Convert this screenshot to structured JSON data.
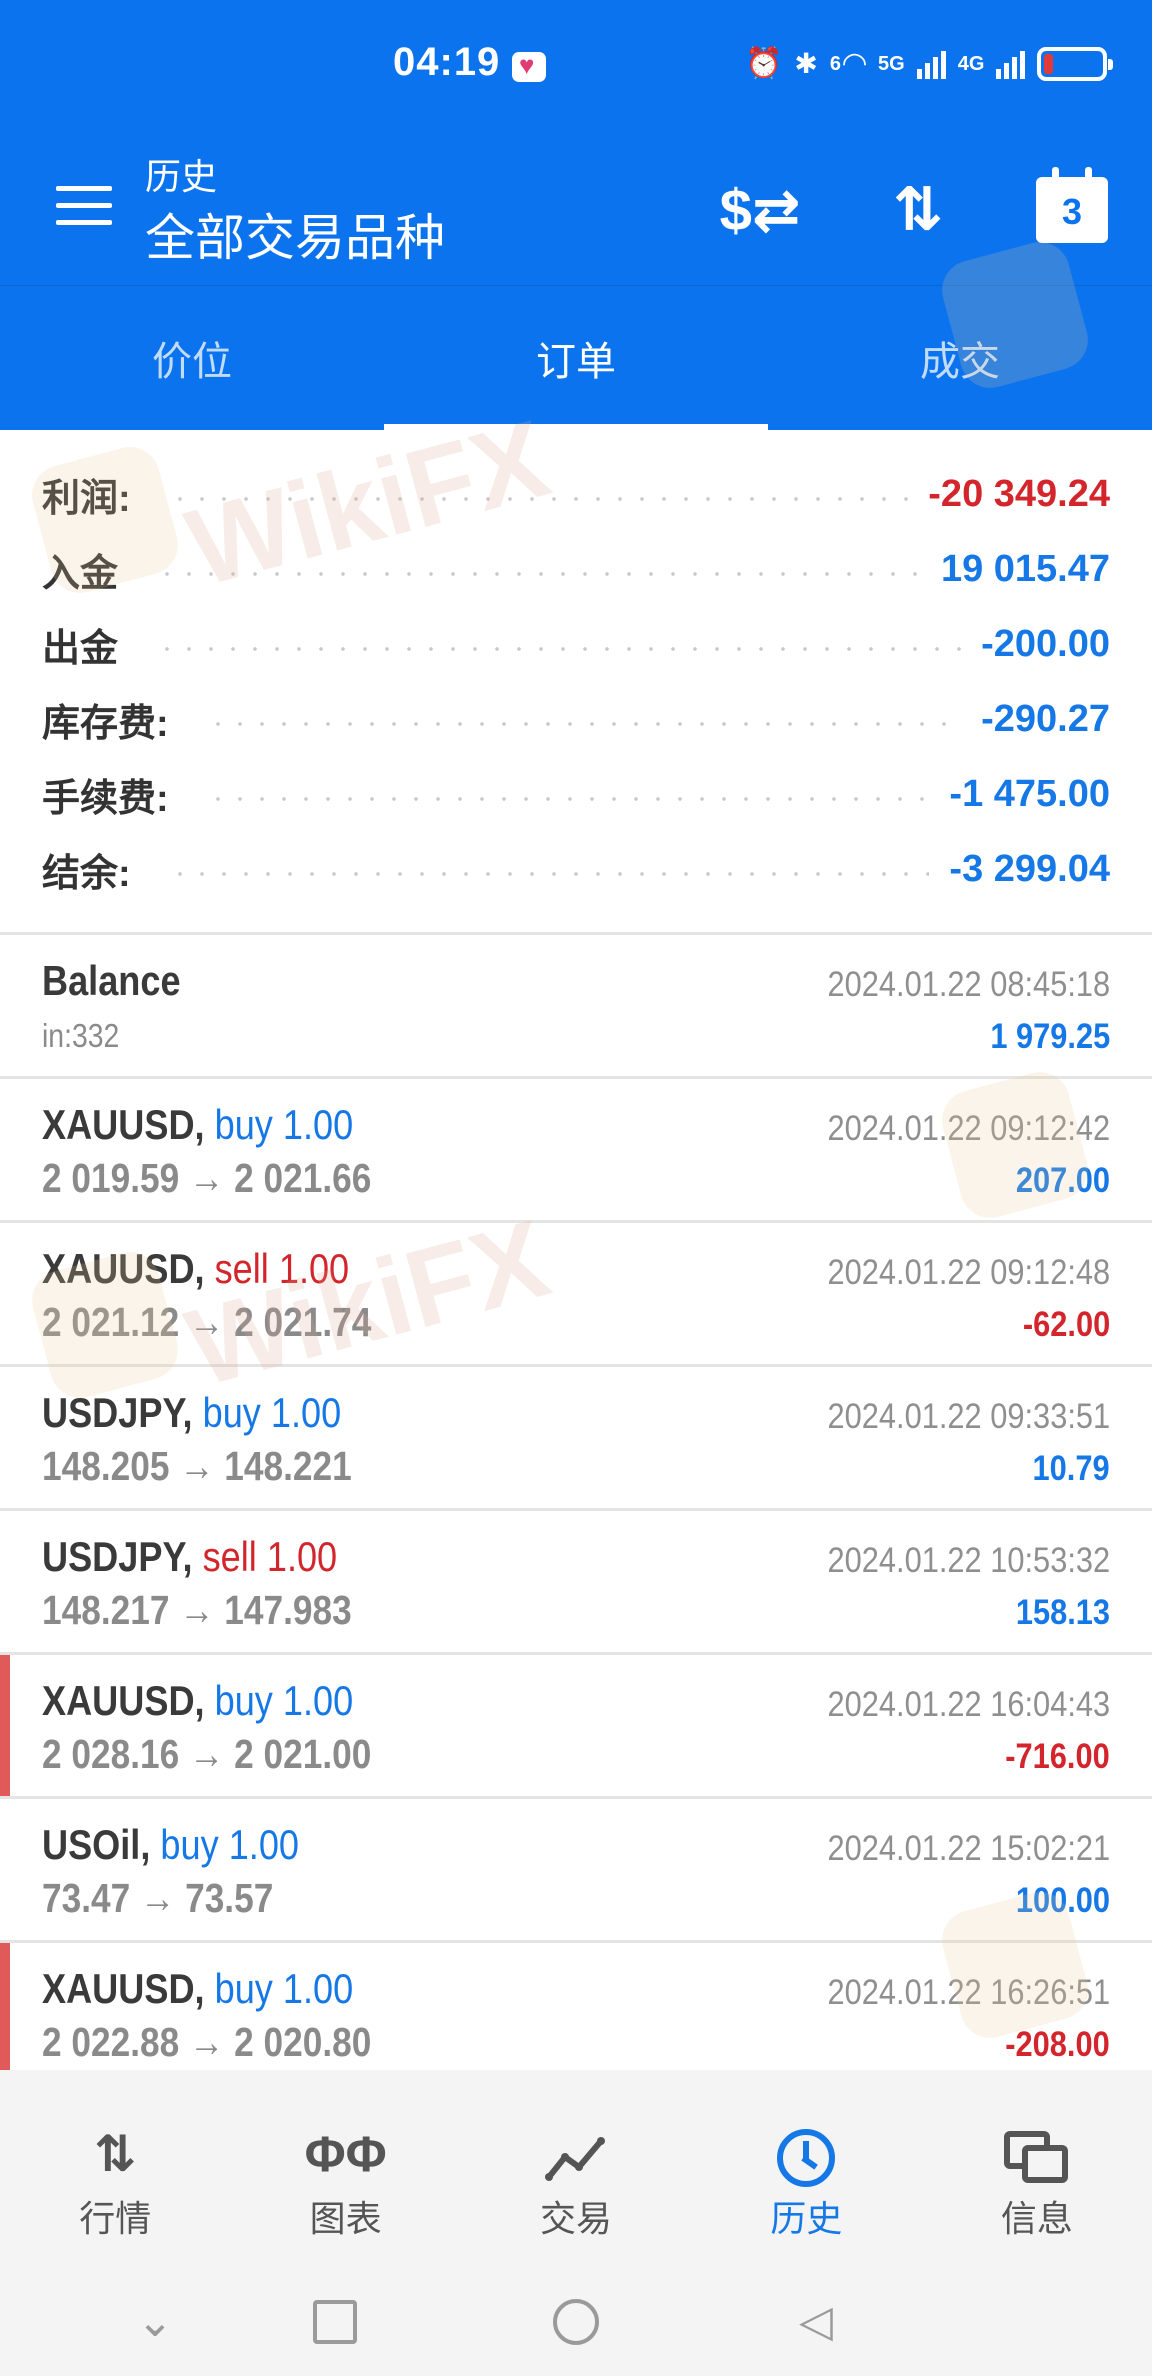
{
  "status_bar": {
    "time": "04:19",
    "network_label_1": "5G",
    "network_label_2": "4G",
    "wifi_sup": "6"
  },
  "app_bar": {
    "subtitle": "历史",
    "title": "全部交易品种",
    "calendar_day": "3",
    "currency_icon": "currency-swap-icon",
    "sort_icon": "sort-icon",
    "calendar_icon": "calendar-icon"
  },
  "tabs": [
    {
      "label": "价位",
      "active": false
    },
    {
      "label": "订单",
      "active": true
    },
    {
      "label": "成交",
      "active": false
    }
  ],
  "summary": [
    {
      "label": "利润:",
      "value": "-20 349.24",
      "color": "red"
    },
    {
      "label": "入金",
      "value": "19 015.47",
      "color": "blue"
    },
    {
      "label": "出金",
      "value": "-200.00",
      "color": "blue"
    },
    {
      "label": "库存费:",
      "value": "-290.27",
      "color": "blue"
    },
    {
      "label": "手续费:",
      "value": "-1 475.00",
      "color": "blue"
    },
    {
      "label": "结余:",
      "value": "-3 299.04",
      "color": "blue"
    }
  ],
  "deals": [
    {
      "symbol": "Balance",
      "type": "",
      "volume": "",
      "sub": "in:332",
      "time": "2024.01.22 08:45:18",
      "profit": "1 979.25",
      "profit_color": "blue",
      "loss_mark": false
    },
    {
      "symbol": "XAUUSD,",
      "type": "buy",
      "volume": "1.00",
      "sub": "2 019.59 → 2 021.66",
      "time": "2024.01.22 09:12:42",
      "profit": "207.00",
      "profit_color": "blue",
      "loss_mark": false
    },
    {
      "symbol": "XAUUSD,",
      "type": "sell",
      "volume": "1.00",
      "sub": "2 021.12 → 2 021.74",
      "time": "2024.01.22 09:12:48",
      "profit": "-62.00",
      "profit_color": "red",
      "loss_mark": false
    },
    {
      "symbol": "USDJPY,",
      "type": "buy",
      "volume": "1.00",
      "sub": "148.205 → 148.221",
      "time": "2024.01.22 09:33:51",
      "profit": "10.79",
      "profit_color": "blue",
      "loss_mark": false
    },
    {
      "symbol": "USDJPY,",
      "type": "sell",
      "volume": "1.00",
      "sub": "148.217 → 147.983",
      "time": "2024.01.22 10:53:32",
      "profit": "158.13",
      "profit_color": "blue",
      "loss_mark": false
    },
    {
      "symbol": "XAUUSD,",
      "type": "buy",
      "volume": "1.00",
      "sub": "2 028.16 → 2 021.00",
      "time": "2024.01.22 16:04:43",
      "profit": "-716.00",
      "profit_color": "red",
      "loss_mark": true
    },
    {
      "symbol": "USOil,",
      "type": "buy",
      "volume": "1.00",
      "sub": "73.47 → 73.57",
      "time": "2024.01.22 15:02:21",
      "profit": "100.00",
      "profit_color": "blue",
      "loss_mark": false
    },
    {
      "symbol": "XAUUSD,",
      "type": "buy",
      "volume": "1.00",
      "sub": "2 022.88 → 2 020.80",
      "time": "2024.01.22 16:26:51",
      "profit": "-208.00",
      "profit_color": "red",
      "loss_mark": true
    }
  ],
  "bottom_nav": [
    {
      "label": "行情",
      "icon": "quotes-arrows-icon",
      "active": false
    },
    {
      "label": "图表",
      "icon": "candlestick-chart-icon",
      "active": false
    },
    {
      "label": "交易",
      "icon": "trade-line-icon",
      "active": false
    },
    {
      "label": "历史",
      "icon": "history-clock-icon",
      "active": true
    },
    {
      "label": "信息",
      "icon": "messages-icon",
      "active": false
    }
  ],
  "watermark": "WikiFX",
  "colors": {
    "header_blue": "#0b73ee",
    "loss_red": "#d3252c",
    "profit_blue": "#1578e6",
    "sell_red": "#d3252c",
    "buy_blue": "#1578e6"
  }
}
